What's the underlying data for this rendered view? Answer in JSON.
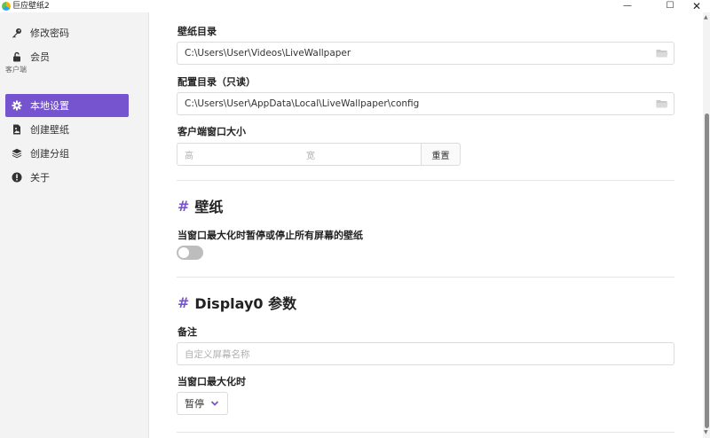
{
  "window": {
    "title": "巨应壁纸2",
    "minimize_glyph": "—",
    "maximize_glyph": "☐",
    "close_glyph": "✕"
  },
  "sidebar": {
    "items_top": [
      {
        "label": "修改密码",
        "icon": "key-icon"
      },
      {
        "label": "会员",
        "icon": "unlock-icon"
      }
    ],
    "section_label": "客户端",
    "items": [
      {
        "label": "本地设置",
        "icon": "gear-icon",
        "active": true
      },
      {
        "label": "创建壁纸",
        "icon": "file-image-icon"
      },
      {
        "label": "创建分组",
        "icon": "layers-icon"
      },
      {
        "label": "关于",
        "icon": "info-icon"
      }
    ]
  },
  "settings": {
    "wallpaper_dir_label": "壁纸目录",
    "wallpaper_dir_value": "C:\\Users\\User\\Videos\\LiveWallpaper",
    "config_dir_label": "配置目录（只读）",
    "config_dir_value": "C:\\Users\\User\\AppData\\Local\\LiveWallpaper\\config",
    "client_size_label": "客户端窗口大小",
    "height_placeholder": "高",
    "width_placeholder": "宽",
    "reset_label": "重置"
  },
  "wallpaper_section": {
    "hash": "#",
    "title": "壁纸",
    "pause_label": "当窗口最大化时暂停或停止所有屏幕的壁纸",
    "pause_enabled": false
  },
  "display_section": {
    "hash": "#",
    "title": "Display0 参数",
    "note_label": "备注",
    "note_placeholder": "自定义屏幕名称",
    "maximize_label": "当窗口最大化时",
    "maximize_value": "暂停"
  },
  "colors": {
    "accent": "#7654cf",
    "sidebar_bg": "#f3f3f3"
  }
}
